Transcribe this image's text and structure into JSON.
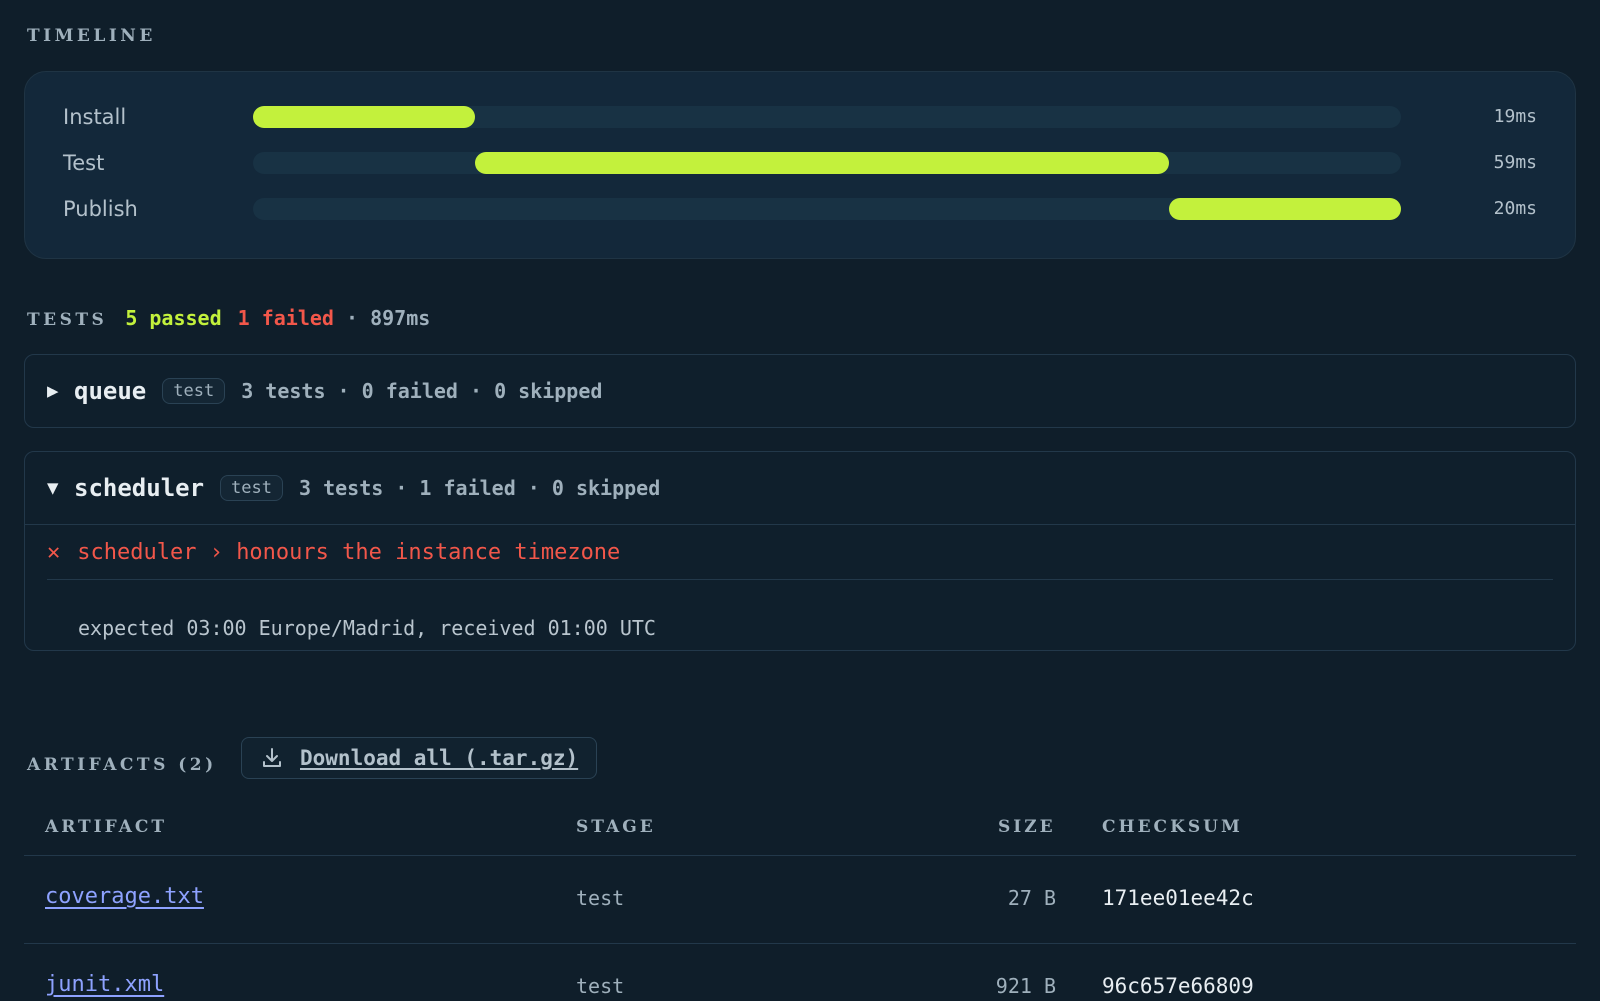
{
  "timeline": {
    "title": "TIMELINE",
    "stages": [
      {
        "label": "Install",
        "time": "19ms",
        "start": 0.0,
        "end": 0.193
      },
      {
        "label": "Test",
        "time": "59ms",
        "start": 0.193,
        "end": 0.798
      },
      {
        "label": "Publish",
        "time": "20ms",
        "start": 0.798,
        "end": 1.0
      }
    ],
    "bar_color": "#c3f13c"
  },
  "tests": {
    "title": "TESTS",
    "passed": "5 passed",
    "failed": "1 failed",
    "duration": "· 897ms",
    "suites": [
      {
        "caret": "▶",
        "name": "queue",
        "tag": "test",
        "meta": "3 tests · 0 failed · 0 skipped",
        "expanded": false
      },
      {
        "caret": "▼",
        "name": "scheduler",
        "tag": "test",
        "meta": "3 tests · 1 failed · 0 skipped",
        "expanded": true,
        "failure": {
          "icon": "✕",
          "name": "scheduler › honours the instance timezone",
          "message": "expected 03:00 Europe/Madrid, received 01:00 UTC"
        }
      }
    ]
  },
  "artifacts": {
    "title": "ARTIFACTS (2)",
    "download_label": "Download all (.tar.gz)",
    "columns": [
      "ARTIFACT",
      "STAGE",
      "SIZE",
      "CHECKSUM"
    ],
    "rows": [
      {
        "name": "coverage.txt",
        "stage": "test",
        "size": "27 B",
        "checksum": "171ee01ee42c"
      },
      {
        "name": "junit.xml",
        "stage": "test",
        "size": "921 B",
        "checksum": "96c657e66809"
      }
    ]
  },
  "colors": {
    "accent": "#c3f13c",
    "failed": "#f2574a",
    "link": "#8ea2ff",
    "background": "#0f1e2a"
  }
}
